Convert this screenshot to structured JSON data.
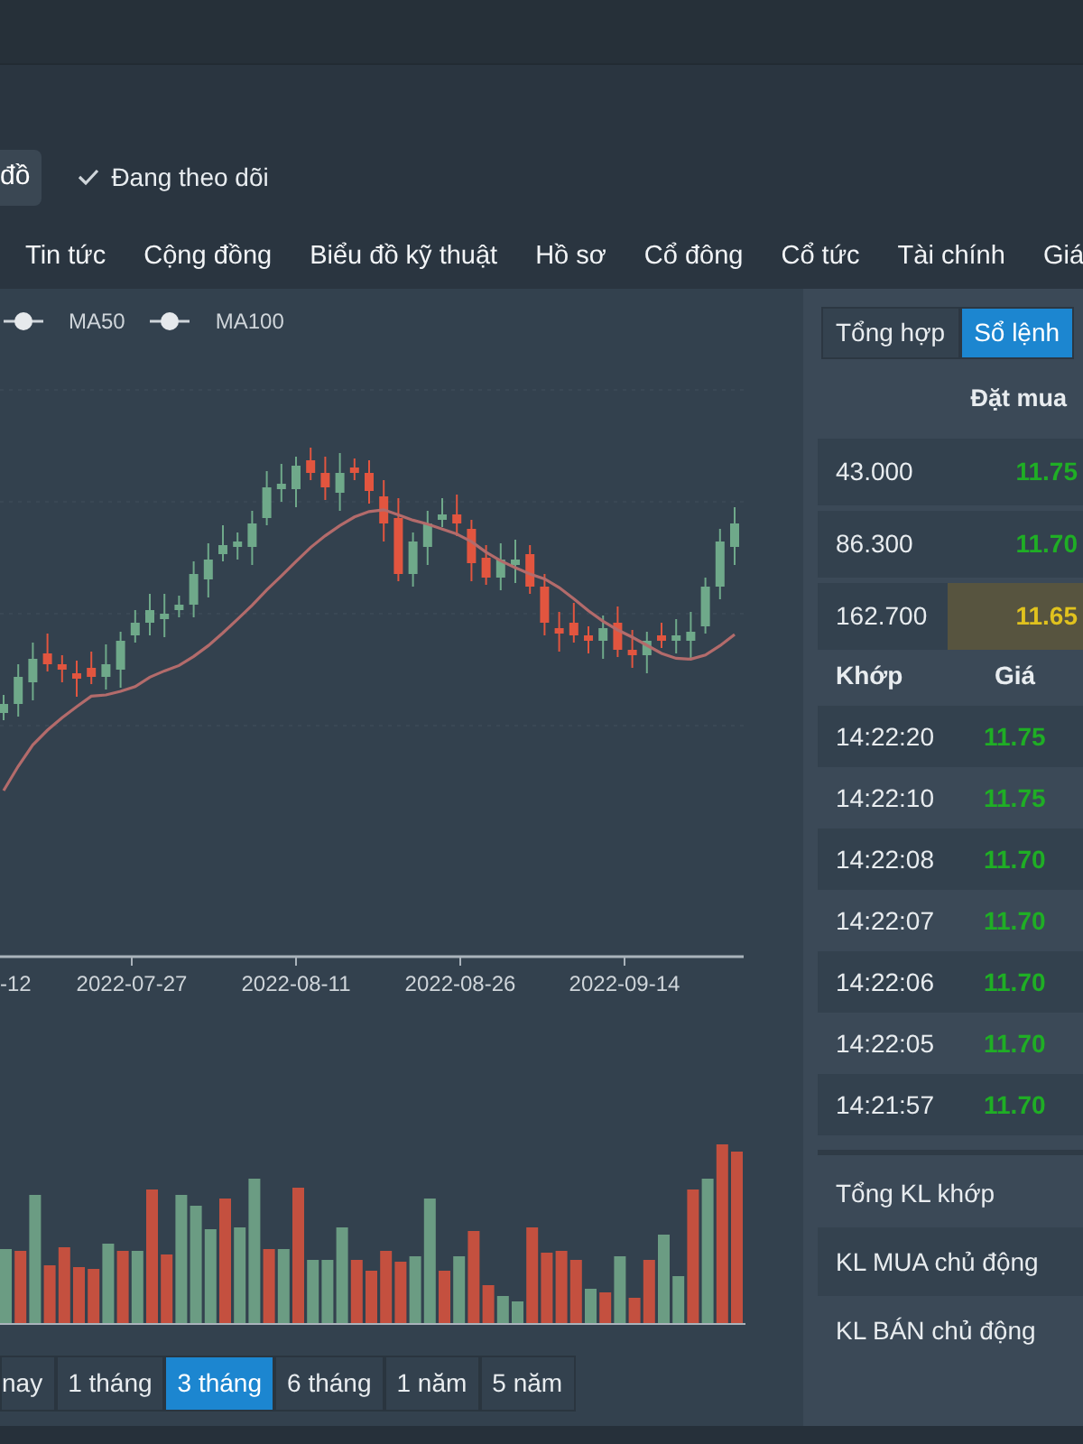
{
  "header": {
    "cut_button": "đồ",
    "follow": {
      "label": "Đang theo dõi",
      "checked": true
    }
  },
  "nav": [
    "Tin tức",
    "Cộng đồng",
    "Biểu đồ kỹ thuật",
    "Hồ sơ",
    "Cổ đông",
    "Cổ tức",
    "Tài chính",
    "Giá"
  ],
  "legend": [
    "MA50",
    "MA100"
  ],
  "chart": {
    "x_labels": [
      "-12",
      "2022-07-27",
      "2022-08-11",
      "2022-08-26",
      "2022-09-14"
    ]
  },
  "ranges": [
    {
      "label": "nay",
      "selected": false
    },
    {
      "label": "1 tháng",
      "selected": false
    },
    {
      "label": "3 tháng",
      "selected": true
    },
    {
      "label": "6 tháng",
      "selected": false
    },
    {
      "label": "1 năm",
      "selected": false
    },
    {
      "label": "5 năm",
      "selected": false
    }
  ],
  "panel": {
    "tabs": [
      {
        "label": "Tổng hợp",
        "selected": false
      },
      {
        "label": "Sổ lệnh",
        "selected": true
      }
    ],
    "book_header": "Đặt mua",
    "book": [
      {
        "volume": "43.000",
        "price": "11.75",
        "kind": "up",
        "highlighted": false
      },
      {
        "volume": "86.300",
        "price": "11.70",
        "kind": "up",
        "highlighted": false
      },
      {
        "volume": "162.700",
        "price": "11.65",
        "kind": "ref",
        "highlighted": true
      }
    ],
    "trades_header": [
      "Khớp",
      "Giá"
    ],
    "trades": [
      {
        "time": "14:22:20",
        "price": "11.75",
        "kind": "up"
      },
      {
        "time": "14:22:10",
        "price": "11.75",
        "kind": "up"
      },
      {
        "time": "14:22:08",
        "price": "11.70",
        "kind": "up"
      },
      {
        "time": "14:22:07",
        "price": "11.70",
        "kind": "up"
      },
      {
        "time": "14:22:06",
        "price": "11.70",
        "kind": "up"
      },
      {
        "time": "14:22:05",
        "price": "11.70",
        "kind": "up"
      },
      {
        "time": "14:21:57",
        "price": "11.70",
        "kind": "up"
      }
    ],
    "summary": [
      "Tổng KL khớp",
      "KL MUA chủ động",
      "KL BÁN chủ động"
    ]
  }
}
